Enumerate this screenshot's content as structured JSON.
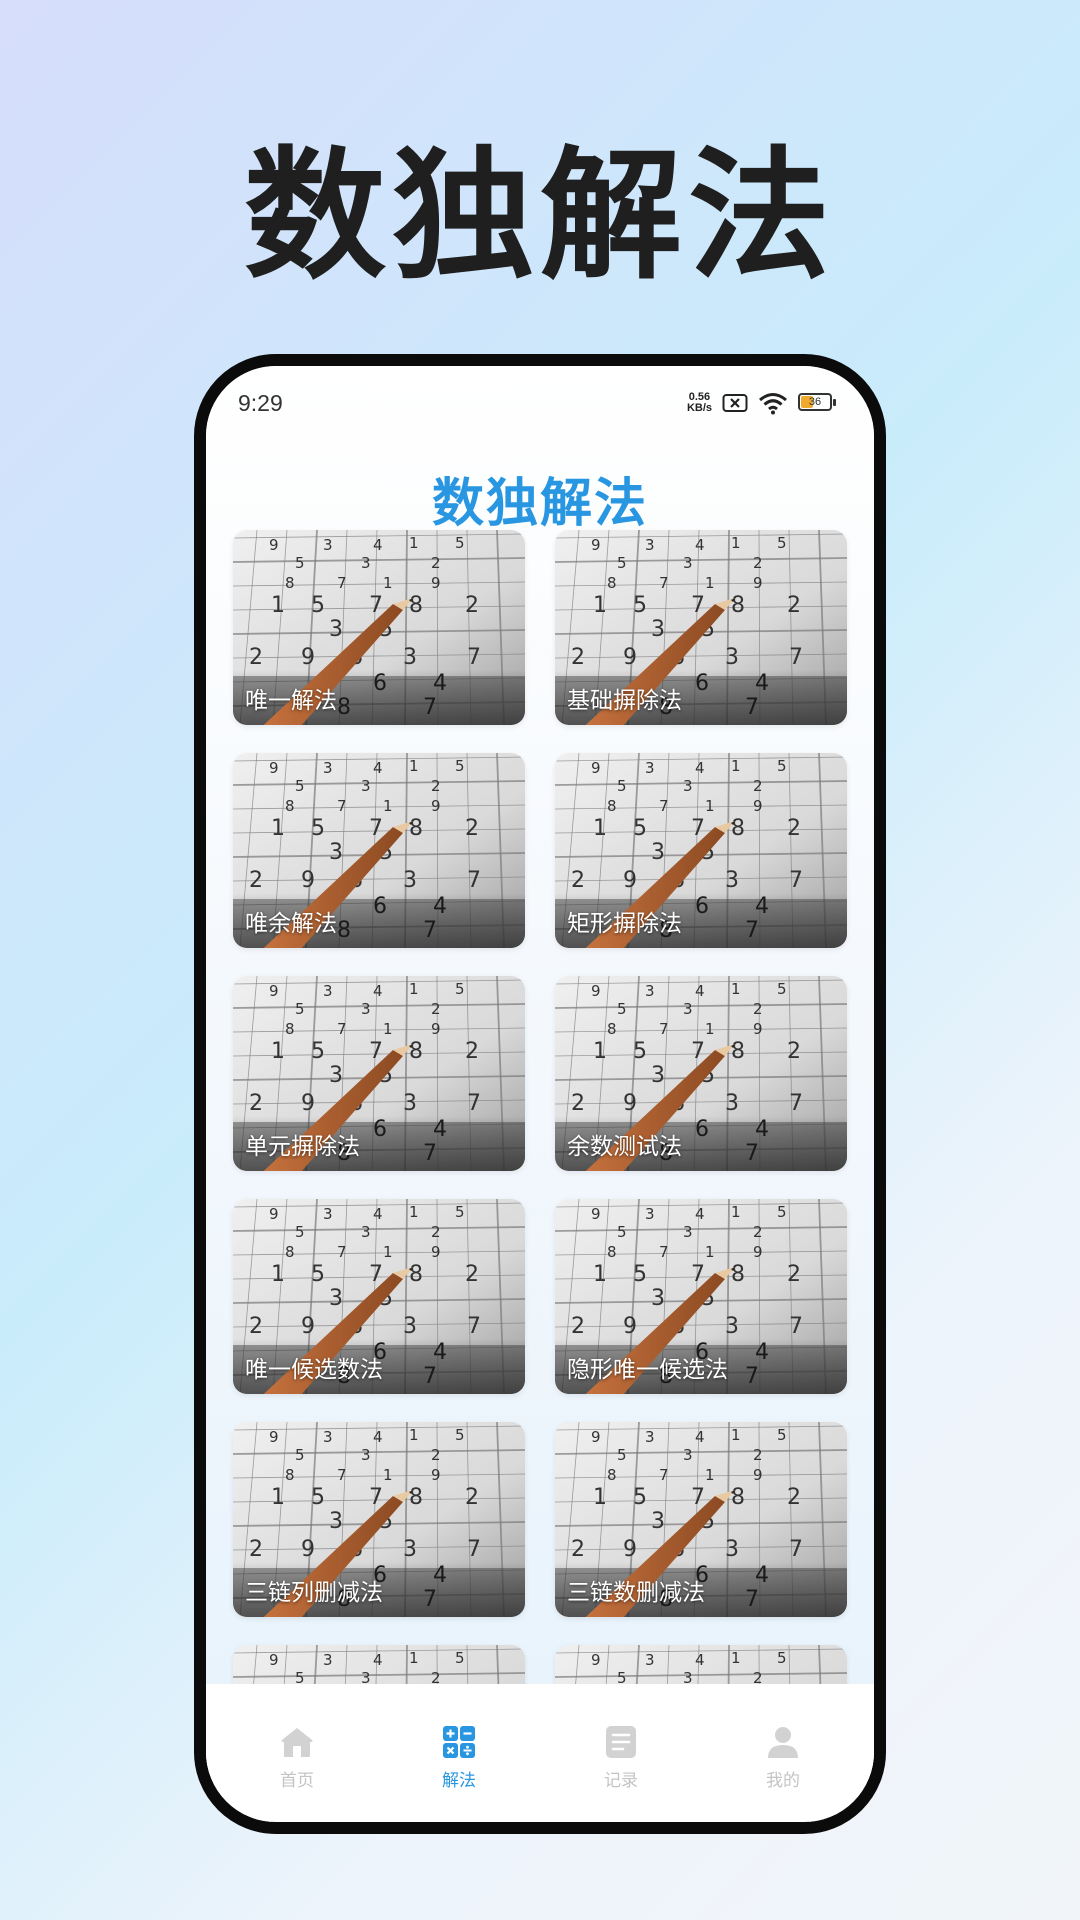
{
  "promo": {
    "title": "数独解法"
  },
  "status_bar": {
    "time": "9:29",
    "net_speed_value": "0.56",
    "net_speed_unit": "KB/s",
    "battery": "36"
  },
  "app": {
    "title": "数独解法"
  },
  "methods": [
    {
      "label": "唯一解法"
    },
    {
      "label": "基础摒除法"
    },
    {
      "label": "唯余解法"
    },
    {
      "label": "矩形摒除法"
    },
    {
      "label": "单元摒除法"
    },
    {
      "label": "余数测试法"
    },
    {
      "label": "唯一候选数法"
    },
    {
      "label": "隐形唯一候选法"
    },
    {
      "label": "三链列删减法"
    },
    {
      "label": "三链数删减法"
    },
    {
      "label": ""
    },
    {
      "label": ""
    }
  ],
  "tabs": [
    {
      "label": "首页",
      "icon": "home-icon",
      "active": false
    },
    {
      "label": "解法",
      "icon": "calculator-icon",
      "active": true
    },
    {
      "label": "记录",
      "icon": "record-icon",
      "active": false
    },
    {
      "label": "我的",
      "icon": "profile-icon",
      "active": false
    }
  ],
  "colors": {
    "accent": "#2996e2",
    "inactive": "#c4c4c4",
    "heading": "#1f1f1f"
  },
  "card_image_digits": [
    "9",
    "3",
    "4",
    "1",
    "5",
    "5",
    "3",
    "2",
    "8",
    "7",
    "1",
    "9",
    "1",
    "5",
    "7",
    "8",
    "2",
    "3",
    "5",
    "2",
    "9",
    "6",
    "3",
    "7",
    "6",
    "4",
    "8",
    "7"
  ]
}
